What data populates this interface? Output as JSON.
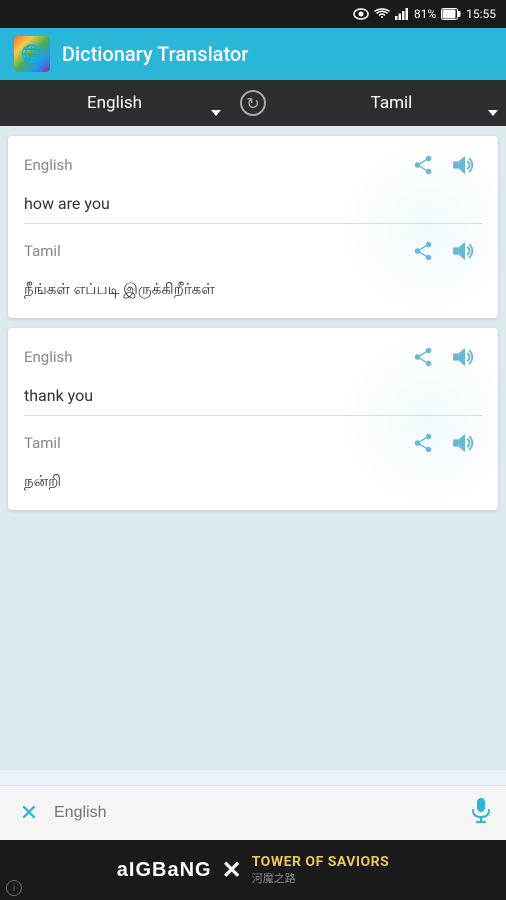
{
  "statusBar": {
    "battery": "81%",
    "time": "15:55"
  },
  "header": {
    "title": "Dictionary Translator",
    "logoEmoji": "🌐"
  },
  "langBar": {
    "sourceLang": "English",
    "targetLang": "Tamil",
    "swapLabel": "swap"
  },
  "cards": [
    {
      "sourceLang": "English",
      "sourceText": "how are you",
      "targetLang": "Tamil",
      "targetText": "நீங்கள் எப்படி இருக்கிறீர்கள்"
    },
    {
      "sourceLang": "English",
      "sourceText": "thank you",
      "targetLang": "Tamil",
      "targetText": "நன்றி"
    }
  ],
  "bottomBar": {
    "placeholder": "English",
    "clearIcon": "✕",
    "micIcon": "🎤"
  },
  "ad": {
    "text1": "aIGBaNG",
    "separator": "✕",
    "text2": "TOWER OF SAVIORS",
    "subtext": "河魔之路"
  }
}
